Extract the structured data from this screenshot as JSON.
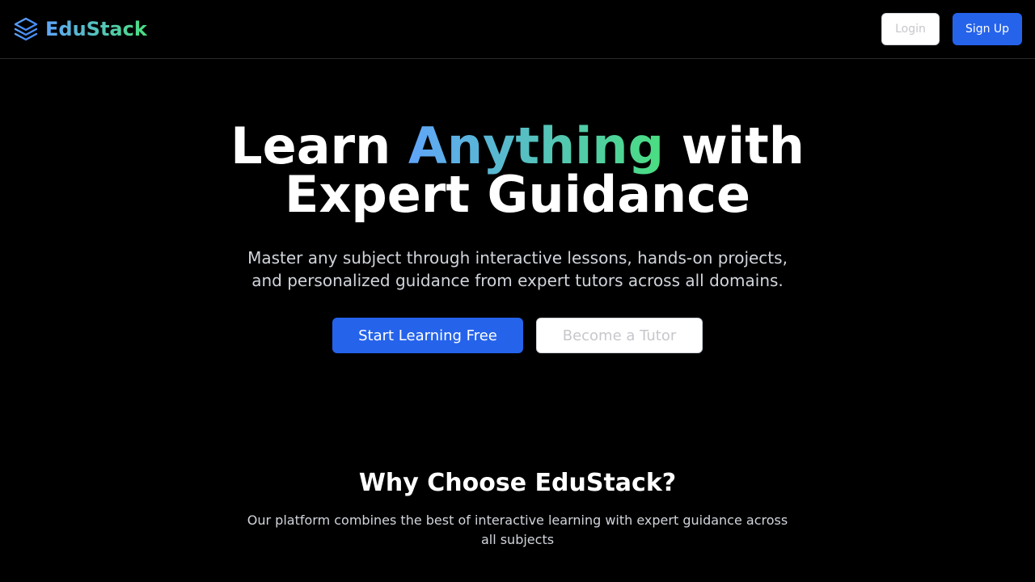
{
  "header": {
    "brand_name": "EduStack",
    "brand_icon": "layers-icon",
    "login_label": "Login",
    "signup_label": "Sign Up"
  },
  "hero": {
    "title_part1": "Learn ",
    "title_accent": "Anything",
    "title_part2": " with",
    "title_line2": "Expert Guidance",
    "subtitle": "Master any subject through interactive lessons, hands-on projects, and personalized guidance from expert tutors across all domains.",
    "primary_cta": "Start Learning Free",
    "secondary_cta": "Become a Tutor"
  },
  "why": {
    "title": "Why Choose EduStack?",
    "subtitle": "Our platform combines the best of interactive learning with expert guidance across all subjects"
  },
  "colors": {
    "background": "#000000",
    "primary": "#2563eb",
    "gradient_start": "#60a5fa",
    "gradient_end": "#4ade80"
  }
}
